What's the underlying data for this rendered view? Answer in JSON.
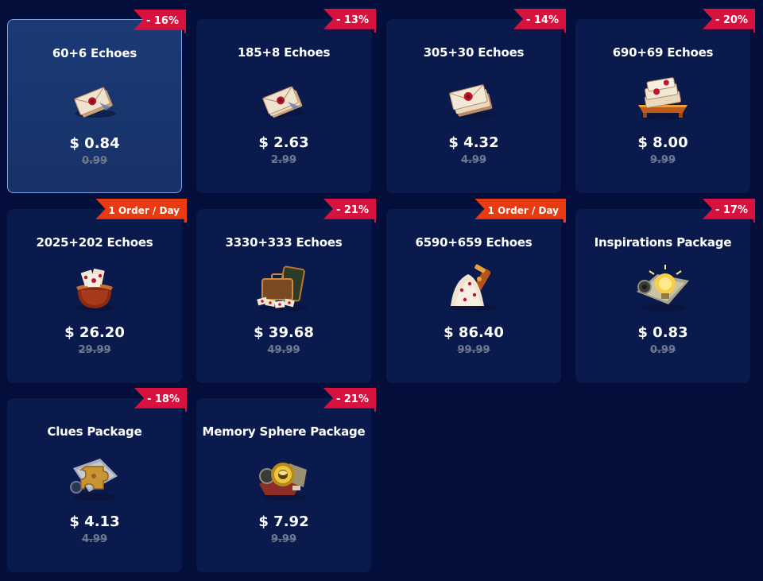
{
  "colors": {
    "page_background": "#030f3a",
    "card_background": "#0a1a4d",
    "selected_card_background": "#1b3a76",
    "selected_border": "#7fa3e6",
    "discount_badge": "#d8123e",
    "limit_badge": "#ea3a12",
    "price_text": "#ffffff",
    "old_price_text": "#6f7891"
  },
  "products": [
    {
      "title": "60+6 Echoes",
      "price": "$ 0.84",
      "old_price": "0.99",
      "badge": "- 16%",
      "badge_type": "discount",
      "icon": "echo-letters-small-icon",
      "selected": true
    },
    {
      "title": "185+8 Echoes",
      "price": "$ 2.63",
      "old_price": "2.99",
      "badge": "- 13%",
      "badge_type": "discount",
      "icon": "echo-letters-small-icon",
      "selected": false
    },
    {
      "title": "305+30 Echoes",
      "price": "$ 4.32",
      "old_price": "4.99",
      "badge": "- 14%",
      "badge_type": "discount",
      "icon": "echo-letters-medium-icon",
      "selected": false
    },
    {
      "title": "690+69 Echoes",
      "price": "$ 8.00",
      "old_price": "9.99",
      "badge": "- 20%",
      "badge_type": "discount",
      "icon": "echo-letters-tray-icon",
      "selected": false
    },
    {
      "title": "2025+202 Echoes",
      "price": "$ 26.20",
      "old_price": "29.99",
      "badge": "1 Order / Day",
      "badge_type": "limit",
      "icon": "letter-bag-icon",
      "selected": false
    },
    {
      "title": "3330+333 Echoes",
      "price": "$ 39.68",
      "old_price": "49.99",
      "badge": "- 21%",
      "badge_type": "discount",
      "icon": "letter-suitcase-icon",
      "selected": false
    },
    {
      "title": "6590+659 Echoes",
      "price": "$ 86.40",
      "old_price": "99.99",
      "badge": "1 Order / Day",
      "badge_type": "limit",
      "icon": "letter-pile-icon",
      "selected": false
    },
    {
      "title": "Inspirations Package",
      "price": "$ 0.83",
      "old_price": "0.99",
      "badge": "- 17%",
      "badge_type": "discount",
      "icon": "lightbulb-package-icon",
      "selected": false
    },
    {
      "title": "Clues Package",
      "price": "$ 4.13",
      "old_price": "4.99",
      "badge": "- 18%",
      "badge_type": "discount",
      "icon": "puzzle-package-icon",
      "selected": false
    },
    {
      "title": "Memory Sphere Package",
      "price": "$ 7.92",
      "old_price": "9.99",
      "badge": "- 21%",
      "badge_type": "discount",
      "icon": "memory-sphere-package-icon",
      "selected": false
    }
  ]
}
